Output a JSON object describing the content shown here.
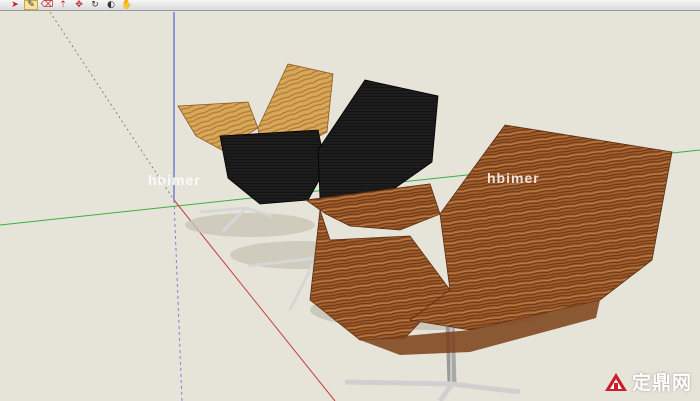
{
  "toolbar": {
    "tools": [
      {
        "name": "select-tool",
        "icon": "arrow-icon",
        "glyph": "➤"
      },
      {
        "name": "pencil-tool",
        "icon": "pencil-icon",
        "glyph": "✎"
      },
      {
        "name": "eraser-tool",
        "icon": "eraser-icon",
        "glyph": "⌫"
      },
      {
        "name": "pushpull-tool",
        "icon": "pushpull-icon",
        "glyph": "⇡"
      },
      {
        "name": "move-tool",
        "icon": "move-icon",
        "glyph": "✥"
      },
      {
        "name": "rotate-tool",
        "icon": "rotate-icon",
        "glyph": "↻"
      },
      {
        "name": "orbit-tool",
        "icon": "orbit-icon",
        "glyph": "◐"
      },
      {
        "name": "pan-tool",
        "icon": "hand-icon",
        "glyph": "✋"
      }
    ]
  },
  "watermarks": {
    "left": "hbimer",
    "right": "hbimer"
  },
  "site_mark": {
    "text": "定鼎网"
  },
  "colors": {
    "background": "#e6e4d8",
    "axis_green": "#3fae3f",
    "axis_blue": "#3b46d6",
    "axis_red": "#c53a3a",
    "light_wood": "#d9a95a",
    "black_chair": "#141414",
    "dark_wood": "#9a5a2c",
    "chrome": "#c4c4c4"
  }
}
